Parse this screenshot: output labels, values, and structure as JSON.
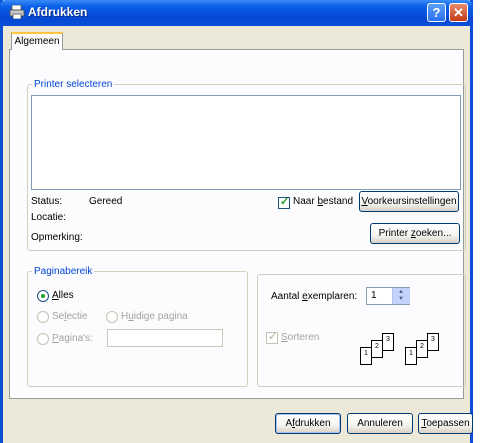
{
  "window": {
    "title": "Afdrukken",
    "help_glyph": "?",
    "close_glyph": "✕"
  },
  "tabs": [
    {
      "label": "Algemeen"
    }
  ],
  "printer_group": {
    "legend": "Printer selecteren",
    "status_label": "Status:",
    "status_value": "Gereed",
    "location_label": "Locatie:",
    "location_value": "",
    "comment_label": "Opmerking:",
    "comment_value": "",
    "print_to_file": {
      "pre": "Naar ",
      "key": "b",
      "post": "estand",
      "checked": true
    },
    "preferences_button": {
      "pre": "",
      "key": "V",
      "post": "oorkeursinstellingen"
    },
    "find_printer_button": {
      "pre": "Printer ",
      "key": "z",
      "post": "oeken..."
    }
  },
  "page_range_group": {
    "legend": "Paginabereik",
    "all": {
      "pre": "",
      "key": "A",
      "post": "lles",
      "selected": true
    },
    "selection": {
      "pre": "Se",
      "key": "l",
      "post": "ectie"
    },
    "current_page": {
      "pre": "H",
      "key": "u",
      "post": "idige pagina"
    },
    "pages": {
      "pre": "",
      "key": "P",
      "post": "agina's:",
      "value": ""
    }
  },
  "copies_group": {
    "copies_label": {
      "pre": "Aantal ",
      "key": "e",
      "post": "xemplaren:"
    },
    "copies_value": "1",
    "collate": {
      "pre": "",
      "key": "S",
      "post": "orteren",
      "checked": true
    },
    "collate_pages": [
      "1",
      "2",
      "3"
    ]
  },
  "footer": {
    "print_button": {
      "pre": "A",
      "key": "f",
      "post": "drukken"
    },
    "cancel_button": {
      "label": "Annuleren"
    },
    "apply_button": {
      "pre": "",
      "key": "T",
      "post": "oepassen"
    }
  },
  "colors": {
    "accent": "#0a4fd6",
    "legend": "#0046d5",
    "check": "#21a121"
  }
}
